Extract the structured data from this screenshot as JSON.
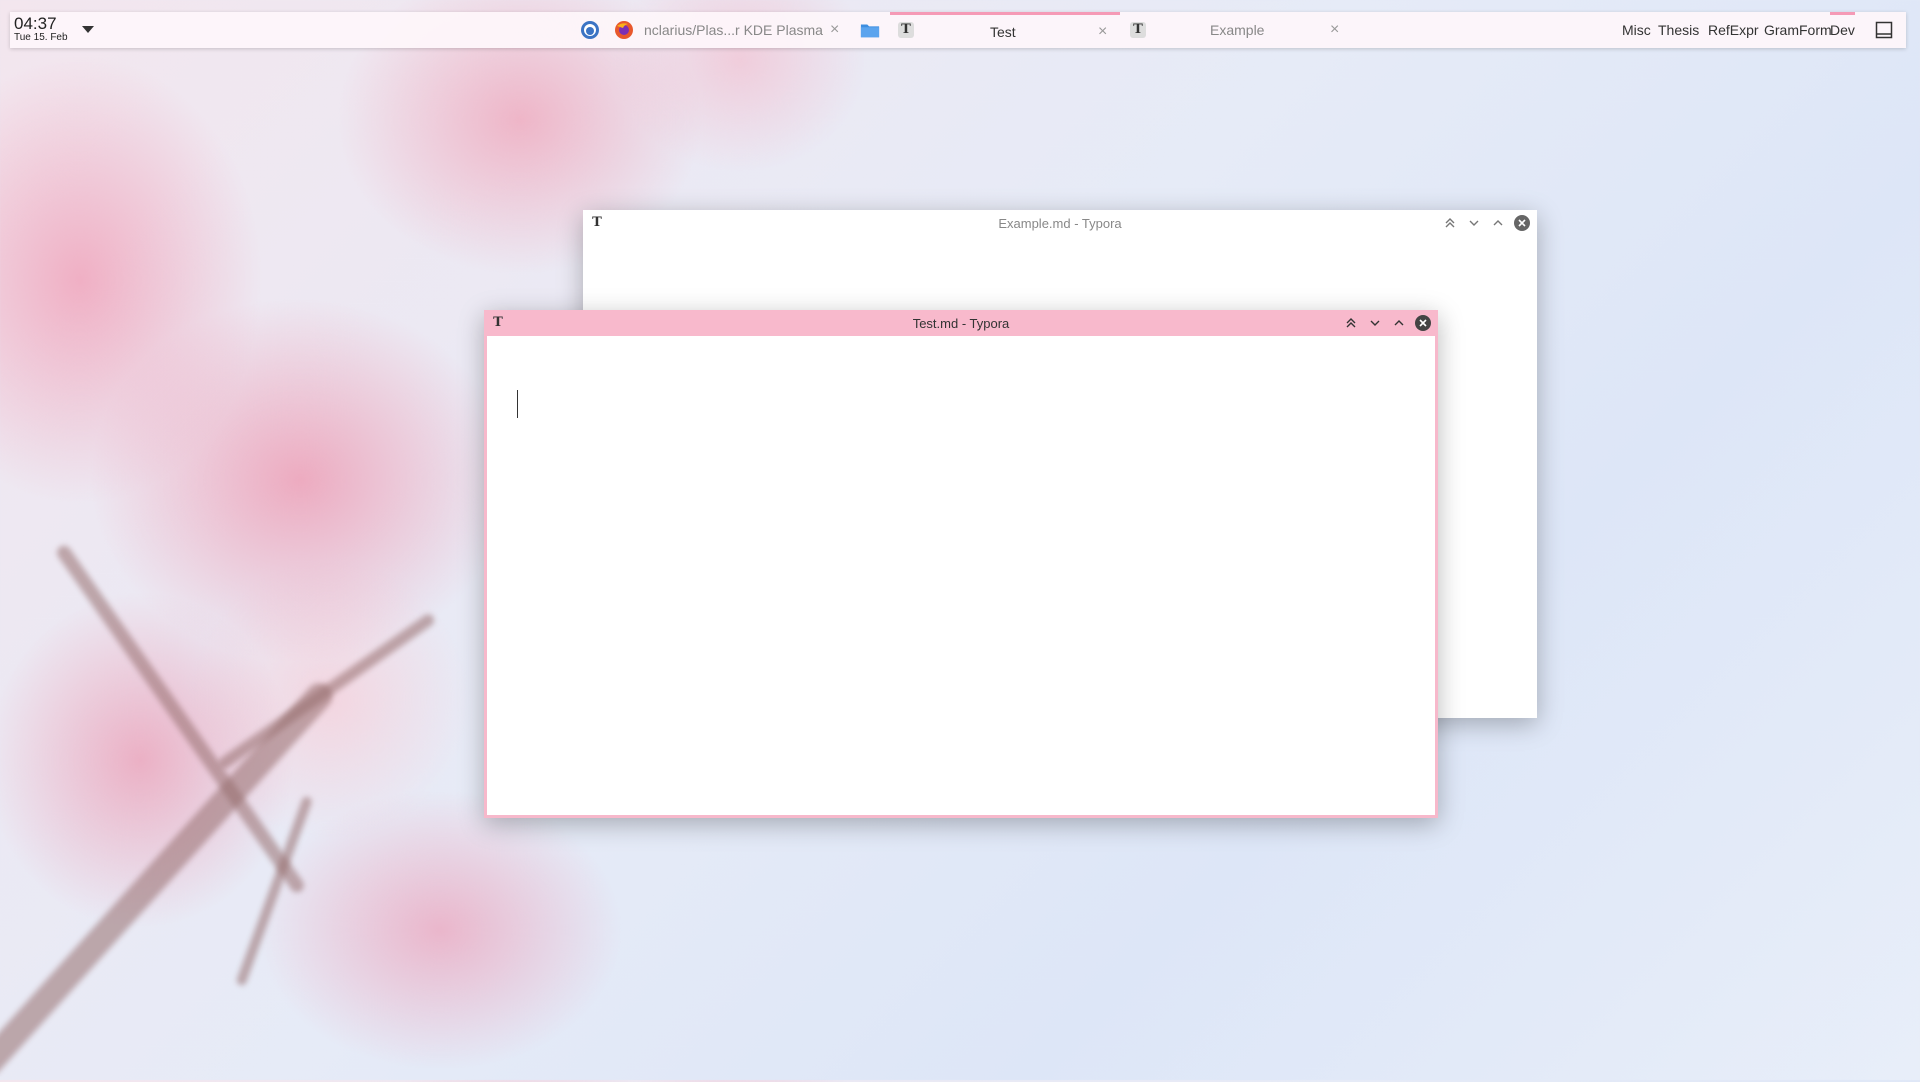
{
  "panel": {
    "clock": {
      "time": "04:37",
      "date": "Tue 15. Feb"
    },
    "tasks": [
      {
        "label": "nclarius/Plas...r KDE Plasma",
        "close": "×"
      },
      {
        "label": "Test",
        "close": "×"
      },
      {
        "label": "Example",
        "close": "×"
      }
    ],
    "desktops": [
      "Misc",
      "Thesis",
      "RefExpr",
      "GramForm",
      "Dev"
    ],
    "active_desktop": "Dev"
  },
  "windows": {
    "back": {
      "title": "Example.md - Typora"
    },
    "front": {
      "title": "Test.md - Typora"
    }
  },
  "icons": {
    "github": "github-icon",
    "firefox": "firefox-icon",
    "files": "folder-icon",
    "typora": "typora-icon",
    "show_desktop": "show-desktop-icon"
  },
  "colors": {
    "accent": "#f59ab6",
    "front_titlebar": "#f8b9cc",
    "close_button": "#444444"
  }
}
